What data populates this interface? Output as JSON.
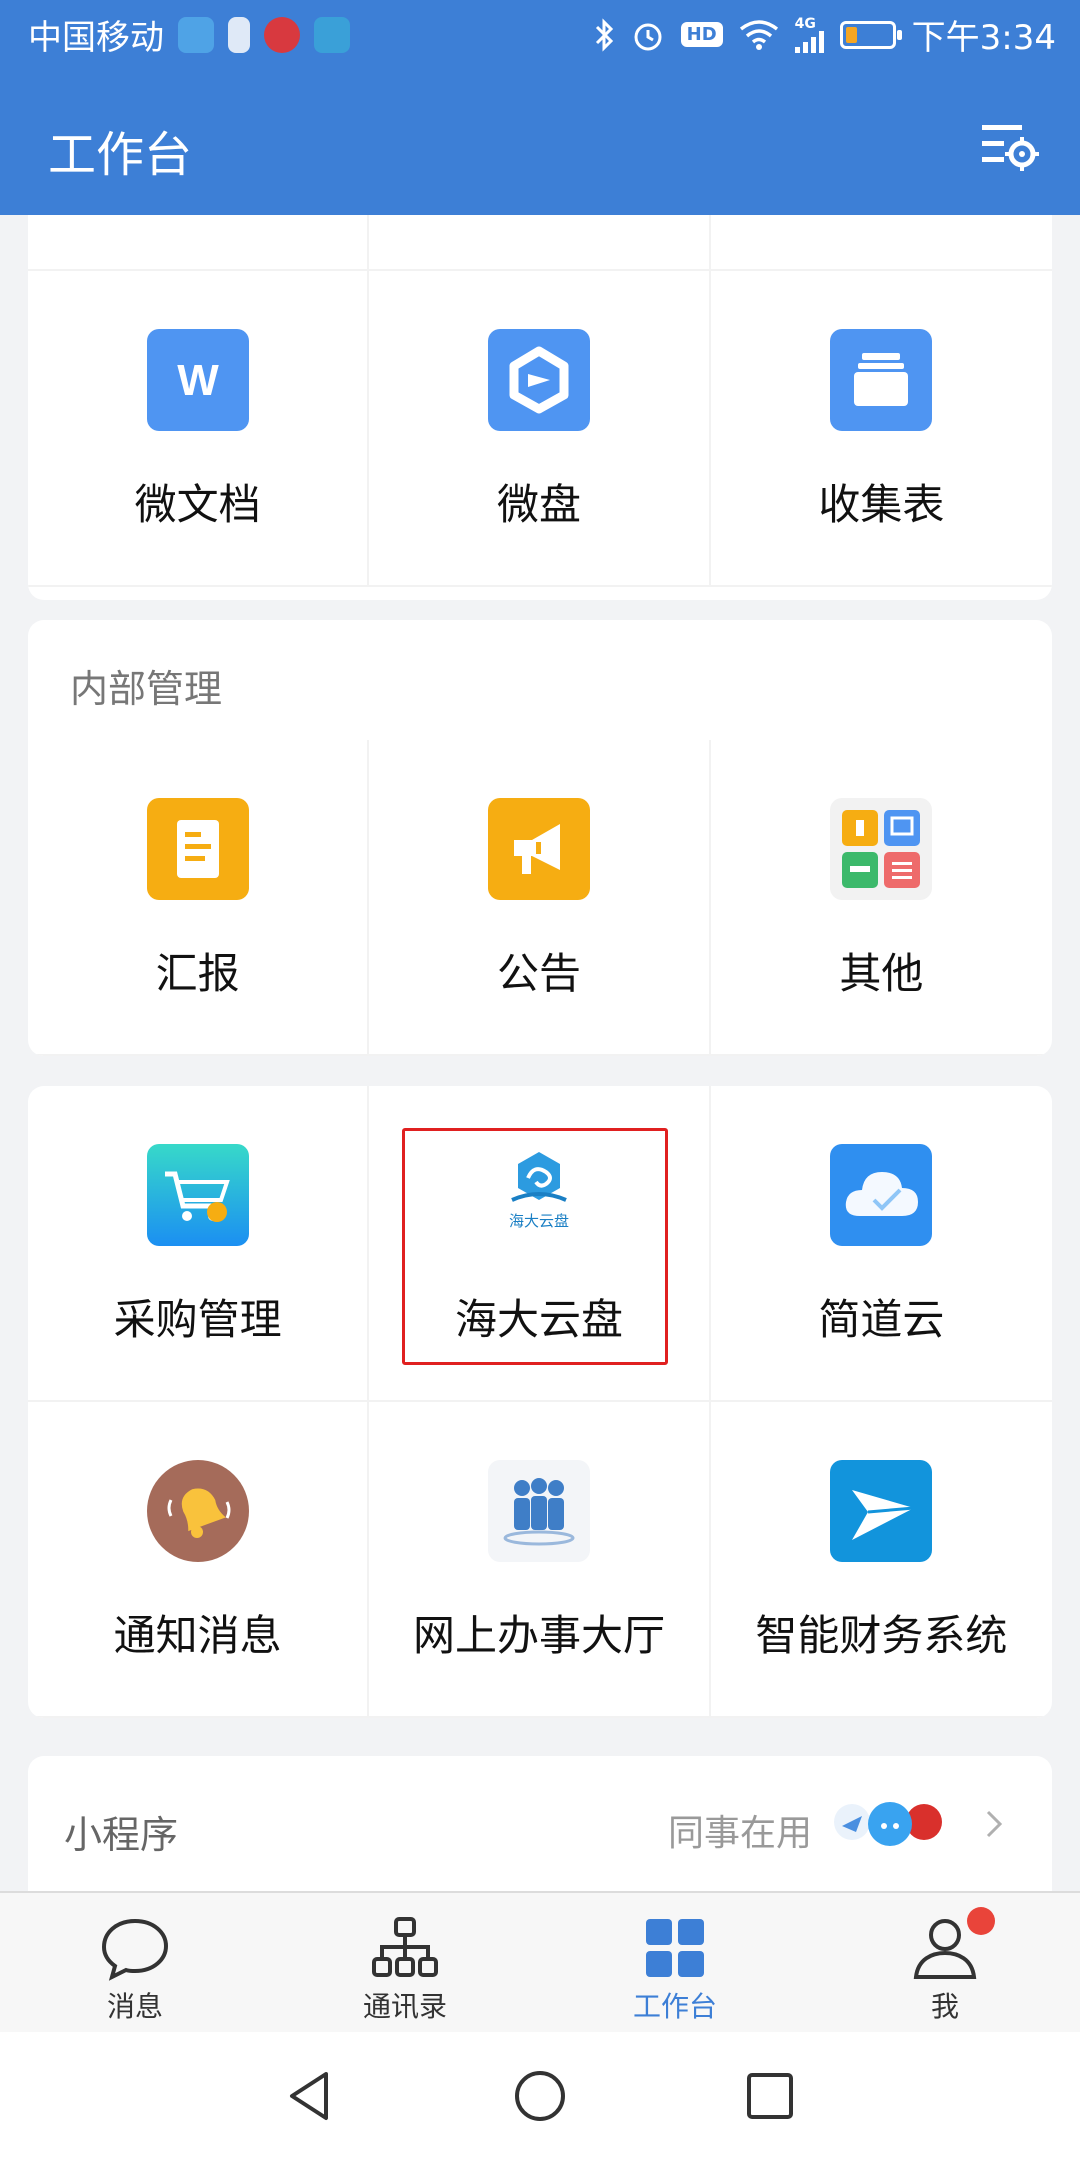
{
  "status_bar": {
    "carrier": "中国移动",
    "network": "4G",
    "badge_hd": "HD",
    "time": "下午3:34",
    "battery_level": 0.25
  },
  "header": {
    "title": "工作台"
  },
  "top_apps": {
    "items": [
      {
        "label": "微文档",
        "icon": "doc-w-icon"
      },
      {
        "label": "微盘",
        "icon": "cloud-disk-icon"
      },
      {
        "label": "收集表",
        "icon": "form-collect-icon"
      }
    ]
  },
  "internal": {
    "title": "内部管理",
    "items": [
      {
        "label": "汇报",
        "icon": "report-icon"
      },
      {
        "label": "公告",
        "icon": "megaphone-icon"
      },
      {
        "label": "其他",
        "icon": "grid-others-icon"
      }
    ]
  },
  "apps": {
    "items": [
      {
        "label": "采购管理",
        "icon": "shopping-cart-icon"
      },
      {
        "label": "海大云盘",
        "icon": "haida-cloud-logo",
        "icon_text": "海大云盘"
      },
      {
        "label": "简道云",
        "icon": "cloud-icon"
      },
      {
        "label": "通知消息",
        "icon": "bell-icon"
      },
      {
        "label": "网上办事大厅",
        "icon": "people-group-icon"
      },
      {
        "label": "智能财务系统",
        "icon": "paper-plane-icon"
      }
    ]
  },
  "mini_programs": {
    "title": "小程序",
    "subtitle": "同事在用"
  },
  "tabbar": {
    "items": [
      {
        "label": "消息",
        "icon": "chat-bubble-icon"
      },
      {
        "label": "通讯录",
        "icon": "org-chart-icon"
      },
      {
        "label": "工作台",
        "icon": "workbench-grid-icon",
        "active": true
      },
      {
        "label": "我",
        "icon": "person-icon"
      }
    ]
  },
  "colors": {
    "brand_blue": "#3d7fd6",
    "active_tab": "#3d7fd6",
    "highlight_border": "#e02020",
    "badge_red": "#e9443a"
  }
}
